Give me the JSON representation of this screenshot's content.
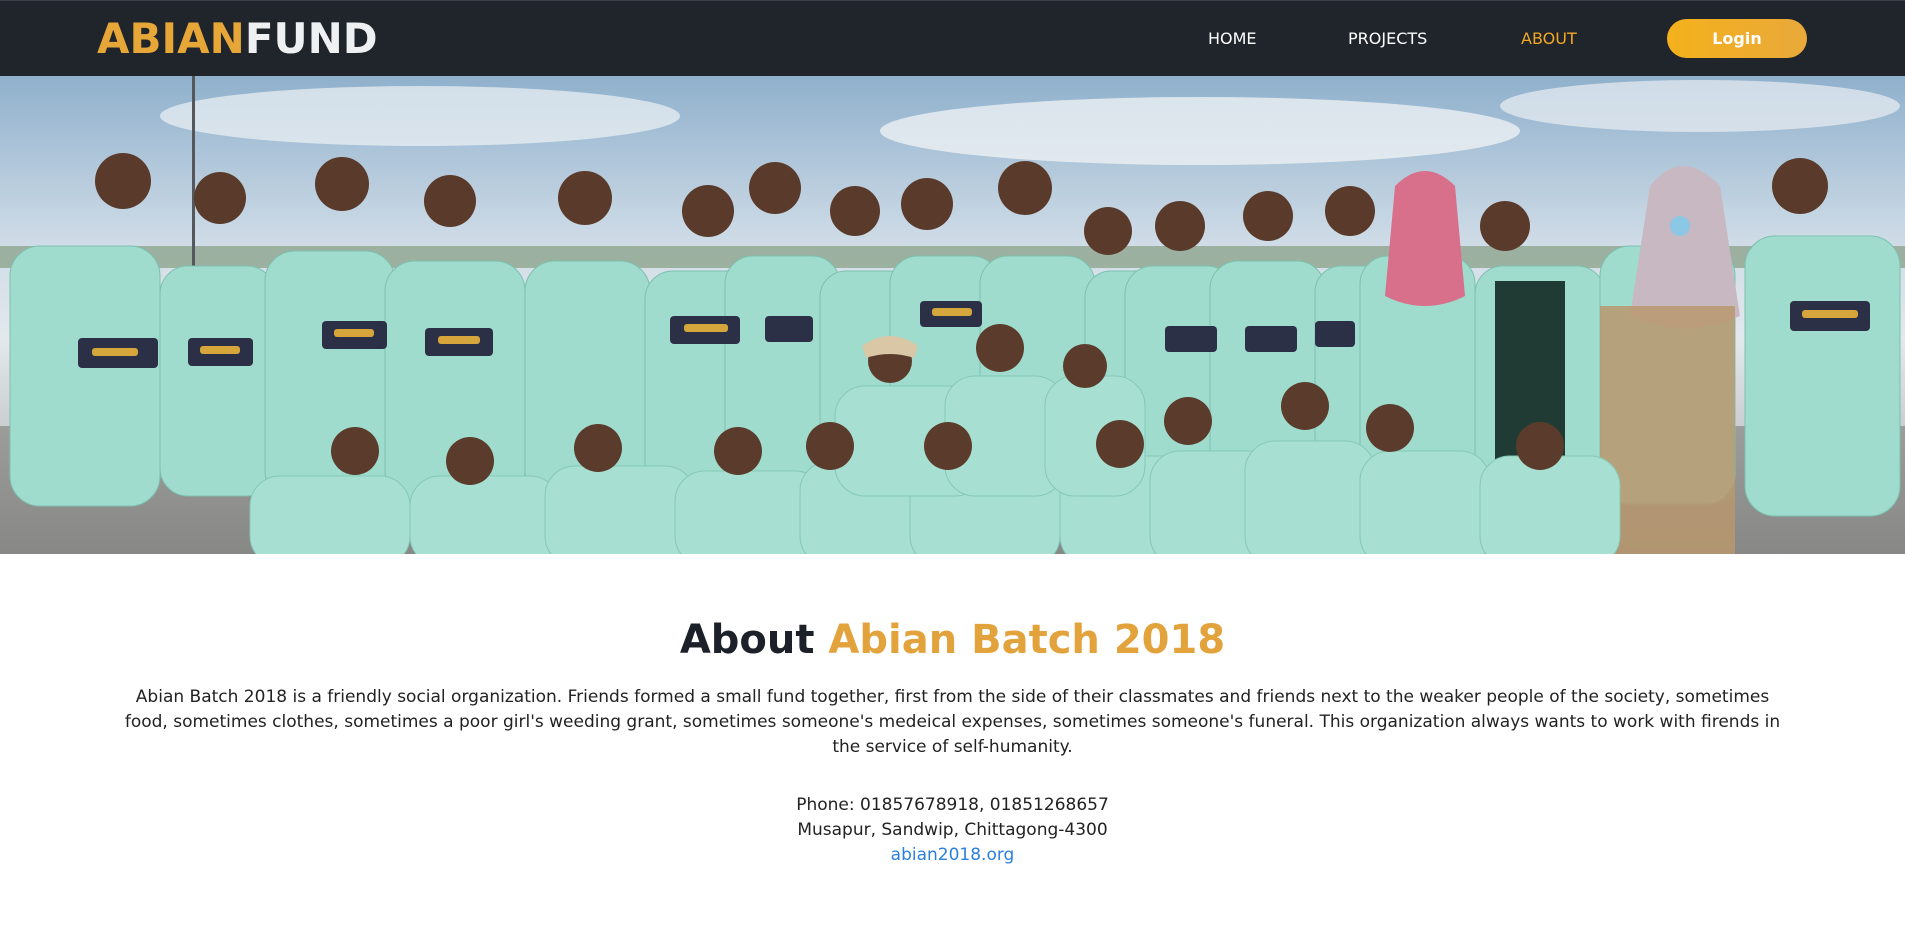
{
  "brand": {
    "part1": "ABIAN",
    "part2": "FUND",
    "accent_color": "#e7a638"
  },
  "nav": {
    "items": [
      {
        "label": "HOME",
        "active": false
      },
      {
        "label": "PROJECTS",
        "active": false
      },
      {
        "label": "ABOUT",
        "active": true
      }
    ],
    "login_label": "Login"
  },
  "hero": {
    "image": "group-photo"
  },
  "about": {
    "title_prefix": "About",
    "title_highlight": "Abian Batch 2018",
    "description": "Abian Batch 2018 is a friendly social organization. Friends formed a small fund together, first from the side of their classmates and friends next to the weaker people of the society, sometimes food, sometimes clothes, sometimes a poor girl's weeding grant, sometimes someone's medeical expenses, sometimes someone's funeral. This organization always wants to work with firends in the service of self-humanity."
  },
  "contact": {
    "phone": "Phone: 01857678918, 01851268657",
    "address": "Musapur, Sandwip, Chittagong-4300",
    "website": "abian2018.org",
    "link_color": "#2b7fe0"
  }
}
